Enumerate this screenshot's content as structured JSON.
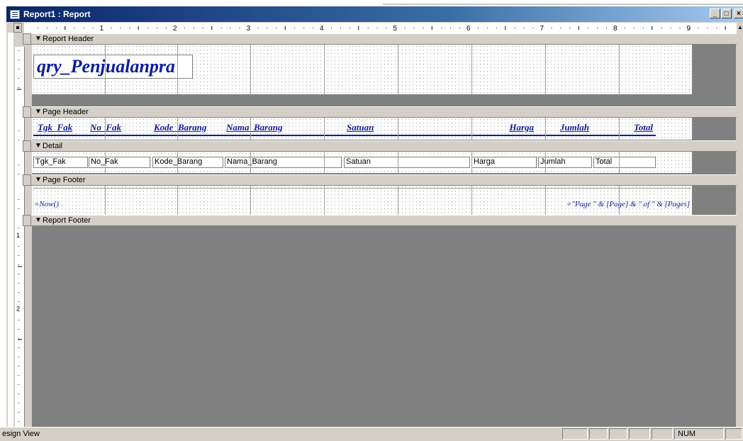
{
  "window": {
    "title": "Report1 : Report",
    "minimize_glyph": "_",
    "restore_glyph": "□",
    "close_glyph": "×"
  },
  "ruler": {
    "horizontal_marks": [
      "1",
      "2",
      "3",
      "4",
      "5",
      "6",
      "7",
      "8",
      "9"
    ],
    "vertical_marks": [
      "1",
      "2"
    ]
  },
  "sections": {
    "report_header": "Report Header",
    "page_header": "Page Header",
    "detail": "Detail",
    "page_footer": "Page Footer",
    "report_footer": "Report Footer"
  },
  "report_header": {
    "title": "qry_Penjualanpra"
  },
  "page_header": {
    "labels": [
      "Tgk_Fak",
      "No_Fak",
      "Kode_Barang",
      "Nama_Barang",
      "Satuan",
      "Harga",
      "Jumlah",
      "Total"
    ]
  },
  "detail": {
    "fields": [
      "Tgk_Fak",
      "No_Fak",
      "Kode_Barang",
      "Nama_Barang",
      "Satuan",
      "Harga",
      "Jumlah",
      "Total"
    ]
  },
  "page_footer": {
    "date_expr": "=Now()",
    "page_expr": "=\"Page \" & [Page] & \" of \" & [Pages]"
  },
  "statusbar": {
    "text": "esign View",
    "num": "NUM"
  },
  "colors": {
    "title_blue": "#0a246a",
    "label_blue": "#0b1ca0",
    "canvas_gray": "#808080",
    "face": "#d4d0c8"
  }
}
